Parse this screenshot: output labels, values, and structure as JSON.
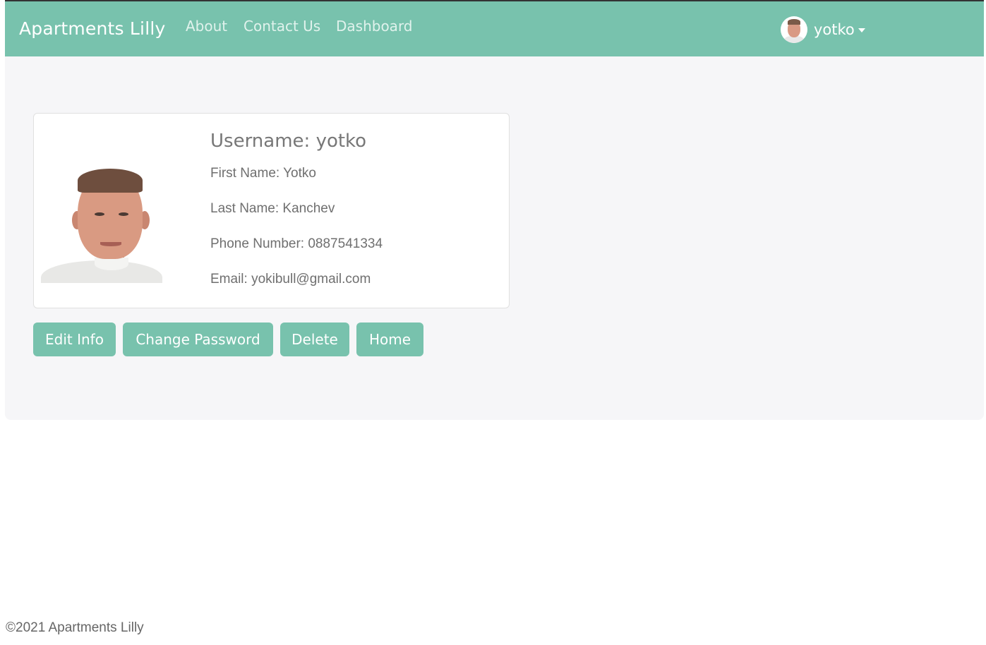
{
  "navbar": {
    "brand": "Apartments Lilly",
    "links": [
      "About",
      "Contact Us",
      "Dashboard"
    ],
    "user": {
      "name": "yotko",
      "avatar_icon": "user-avatar",
      "dropdown_icon": "caret-down-icon"
    }
  },
  "profile": {
    "username_line": "Username: yotko",
    "fields": [
      "First Name: Yotko",
      "Last Name: Kanchev",
      "Phone Number: 0887541334",
      "Email: yokibull@gmail.com"
    ],
    "photo_icon": "profile-photo"
  },
  "actions": [
    "Edit Info",
    "Change Password",
    "Delete",
    "Home"
  ],
  "footer": {
    "text": "©2021 Apartments Lilly"
  },
  "colors": {
    "primary": "#78c2ad",
    "background": "#f6f6f8",
    "text": "#777777"
  }
}
